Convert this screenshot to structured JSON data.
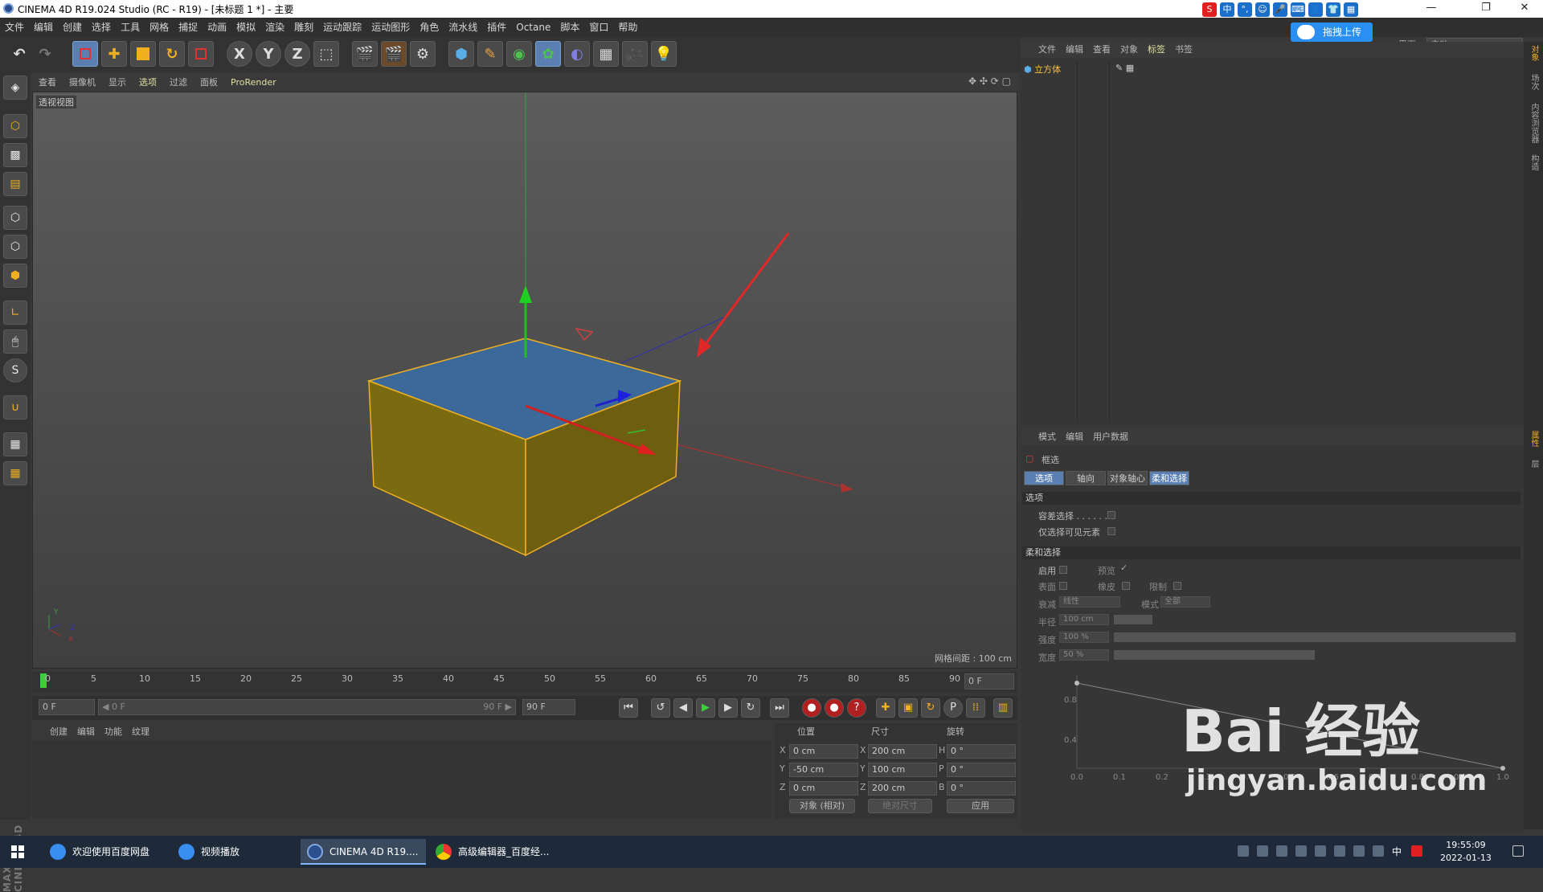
{
  "window": {
    "title": "CINEMA 4D R19.024 Studio (RC - R19) - [未标题 1 *] - 主要",
    "min": "—",
    "max": "❐",
    "close": "✕"
  },
  "menu": [
    "文件",
    "编辑",
    "创建",
    "选择",
    "工具",
    "网格",
    "捕捉",
    "动画",
    "模拟",
    "渲染",
    "雕刻",
    "运动跟踪",
    "运动图形",
    "角色",
    "流水线",
    "插件",
    "Octane",
    "脚本",
    "窗口",
    "帮助"
  ],
  "interface": {
    "label": "界面:",
    "value": "启动"
  },
  "upload": "拖拽上传",
  "ime": [
    "S",
    "中",
    "°,",
    "☺",
    "🎤",
    "⌨",
    "👤",
    "👕",
    "▦"
  ],
  "toolbar": {
    "x": "X",
    "y": "Y",
    "z": "Z"
  },
  "viewport_menu": [
    "查看",
    "摄像机",
    "显示",
    "选项",
    "过滤",
    "面板",
    "ProRender"
  ],
  "viewport": {
    "label": "透视视图",
    "grid": "网格间距 : 100 cm",
    "axis_y": "Y",
    "axis_z": "Z",
    "axis_x": "X"
  },
  "timeline": {
    "ticks": [
      "0",
      "5",
      "10",
      "15",
      "20",
      "25",
      "30",
      "35",
      "40",
      "45",
      "50",
      "55",
      "60",
      "65",
      "70",
      "75",
      "80",
      "85",
      "90"
    ],
    "frame": "0 F"
  },
  "playbar": {
    "start": "0 F",
    "range_left": "◀ 0 F",
    "range_right": "90 F ▶",
    "end": "90 F"
  },
  "material_menu": [
    "创建",
    "编辑",
    "功能",
    "纹理"
  ],
  "coords": {
    "headers": [
      "位置",
      "尺寸",
      "旋转"
    ],
    "rows": [
      {
        "axis": "X",
        "pos": "0 cm",
        "sizeaxis": "X",
        "size": "200 cm",
        "rotaxis": "H",
        "rot": "0 °"
      },
      {
        "axis": "Y",
        "pos": "-50 cm",
        "sizeaxis": "Y",
        "size": "100 cm",
        "rotaxis": "P",
        "rot": "0 °"
      },
      {
        "axis": "Z",
        "pos": "0 cm",
        "sizeaxis": "Z",
        "size": "200 cm",
        "rotaxis": "B",
        "rot": "0 °"
      }
    ],
    "mode1": "对象 (相对)",
    "mode2": "绝对尺寸",
    "apply": "应用"
  },
  "objmgr": {
    "menu": [
      "文件",
      "编辑",
      "查看",
      "对象",
      "标签",
      "书签"
    ],
    "object": "立方体"
  },
  "attr": {
    "menu": [
      "模式",
      "编辑",
      "用户数据"
    ],
    "tool": "框选",
    "tabs": [
      "选项",
      "轴向",
      "对象轴心",
      "柔和选择"
    ],
    "section1": "选项",
    "opt1": "容差选择 . . . . . .",
    "opt2": "仅选择可见元素",
    "section2": "柔和选择",
    "enable": "启用",
    "preview": "预览",
    "preview_check": "✓",
    "surface": "表面",
    "rubber": "橡皮",
    "limit": "限制",
    "falloff": "衰减",
    "falloff_val": "线性",
    "mode": "模式",
    "mode_val": "全部",
    "radius": "半径",
    "radius_val": "100 cm",
    "strength": "强度",
    "strength_val": "100 %",
    "width": "宽度",
    "width_val": "50 %",
    "graph_y": [
      "0.8",
      "0.4"
    ],
    "graph_x": [
      "0.0",
      "0.1",
      "0.2",
      "0.3",
      "0.4",
      "0.5",
      "0.6",
      "0.7",
      "0.8",
      "0.9",
      "1.0"
    ]
  },
  "rstrip": [
    "对象",
    "场次",
    "内容浏览器",
    "构造",
    "属性",
    "层"
  ],
  "taskbar": {
    "items": [
      "欢迎使用百度网盘",
      "视频播放",
      "CINEMA 4D R19....",
      "高级编辑器_百度经..."
    ],
    "time": "19:55:09",
    "date": "2022-01-13",
    "lang": "中"
  },
  "watermark": {
    "brand": "Bai  经验",
    "url": "jingyan.baidu.com"
  }
}
